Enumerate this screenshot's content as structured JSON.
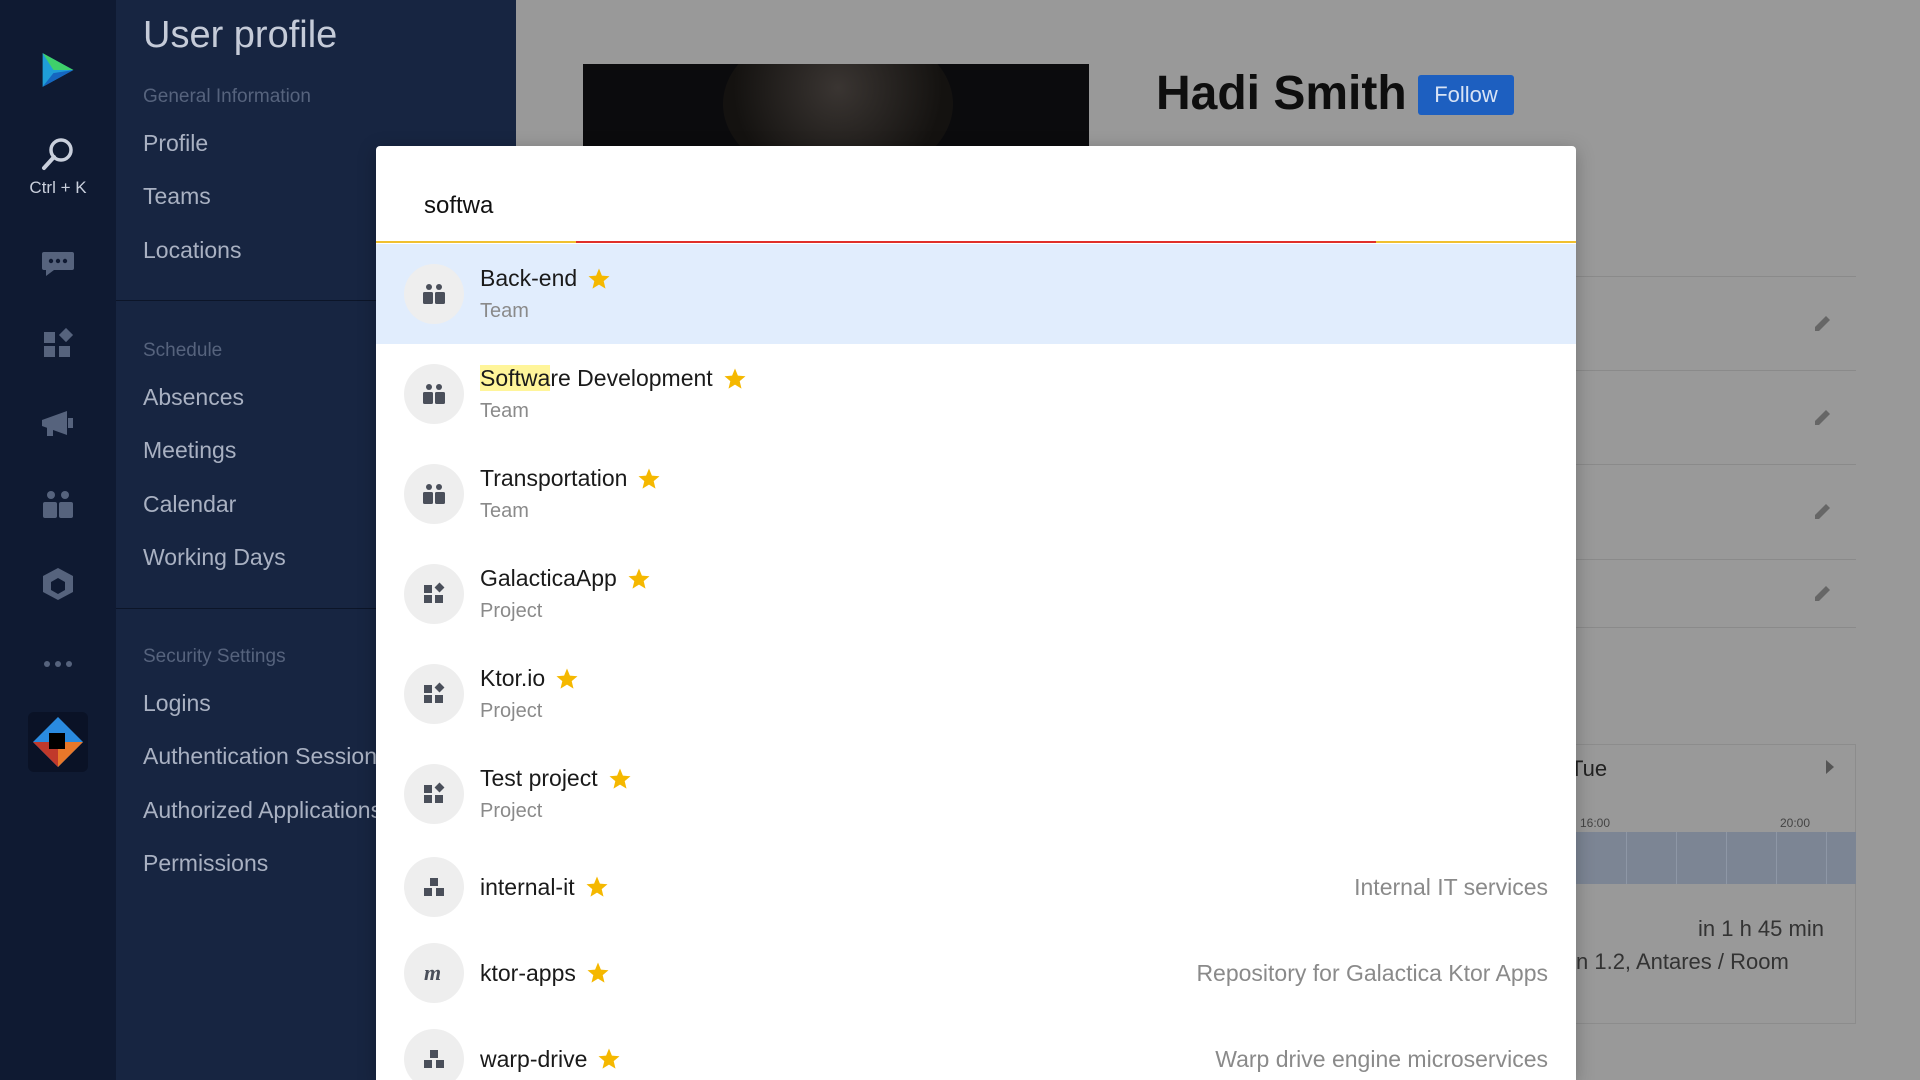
{
  "rail": {
    "search_shortcut": "Ctrl + K",
    "icons": [
      "app-logo-icon",
      "search-icon",
      "chat-icon",
      "projects-icon",
      "announcements-icon",
      "teams-icon",
      "packages-icon",
      "more-icon",
      "toolbox-icon"
    ]
  },
  "sidebar": {
    "title": "User profile",
    "sections": [
      {
        "header": "General Information",
        "items": [
          "Profile",
          "Teams",
          "Locations"
        ]
      },
      {
        "header": "Schedule",
        "items": [
          "Absences",
          "Meetings",
          "Calendar",
          "Working Days"
        ]
      },
      {
        "header": "Security Settings",
        "items": [
          "Logins",
          "Authentication Sessions",
          "Authorized Applications",
          "Permissions"
        ]
      }
    ]
  },
  "profile": {
    "name": "Hadi Smith",
    "follow_label": "Follow",
    "calendar": {
      "day": "Tue",
      "ticks": [
        "16:00",
        "20:00"
      ],
      "meeting_time": "in 1 h 45 min",
      "meeting_room": "n 1.2, Antares / Room"
    }
  },
  "search": {
    "query": "softwa",
    "results": [
      {
        "title": "Back-end",
        "type": "Team",
        "icon": "team-icon",
        "favorite": true,
        "selected": true,
        "description": ""
      },
      {
        "title_match": "Softwa",
        "title_rest": "re Development",
        "title": "Software Development",
        "type": "Team",
        "icon": "team-icon",
        "favorite": true,
        "selected": false,
        "description": ""
      },
      {
        "title": "Transportation",
        "type": "Team",
        "icon": "team-icon",
        "favorite": true,
        "selected": false,
        "description": ""
      },
      {
        "title": "GalacticaApp",
        "type": "Project",
        "icon": "project-icon",
        "favorite": true,
        "selected": false,
        "description": ""
      },
      {
        "title": "Ktor.io",
        "type": "Project",
        "icon": "project-icon",
        "favorite": true,
        "selected": false,
        "description": ""
      },
      {
        "title": "Test project",
        "type": "Project",
        "icon": "project-icon",
        "favorite": true,
        "selected": false,
        "description": ""
      },
      {
        "title": "internal-it",
        "type": "",
        "icon": "repository-icon",
        "favorite": true,
        "selected": false,
        "description": "Internal IT services"
      },
      {
        "title": "ktor-apps",
        "type": "",
        "icon": "m-letter-icon",
        "favorite": true,
        "selected": false,
        "description": "Repository for Galactica Ktor Apps"
      },
      {
        "title": "warp-drive",
        "type": "",
        "icon": "repository-icon",
        "favorite": true,
        "selected": false,
        "description": "Warp drive engine microservices"
      }
    ]
  },
  "colors": {
    "rail_bg": "#0f1a32",
    "sidebar_bg": "#172541",
    "selected_row": "#e1edfd",
    "star": "#f5b800",
    "follow_button": "#1d5fc0",
    "match_highlight": "#fff59a"
  }
}
